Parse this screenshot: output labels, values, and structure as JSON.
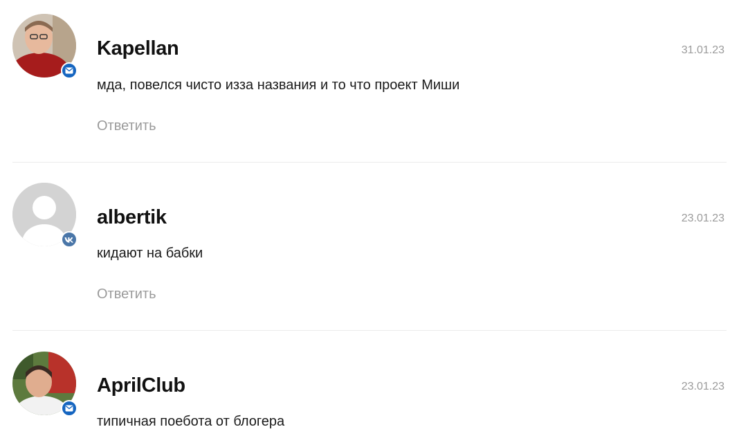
{
  "comments": [
    {
      "author": "Kapellan",
      "date": "31.01.23",
      "text": "мда, повелся чисто изза названия и то что проект Миши",
      "reply_label": "Ответить",
      "source_icon": "mail-icon",
      "badge_color": "#1565c0"
    },
    {
      "author": "albertik",
      "date": "23.01.23",
      "text": "кидают на бабки",
      "reply_label": "Ответить",
      "source_icon": "vk-icon",
      "badge_color": "#4a76a8"
    },
    {
      "author": "AprilClub",
      "date": "23.01.23",
      "text": "типичная поебота от блогера",
      "source_icon": "mail-icon",
      "badge_color": "#1565c0"
    }
  ]
}
